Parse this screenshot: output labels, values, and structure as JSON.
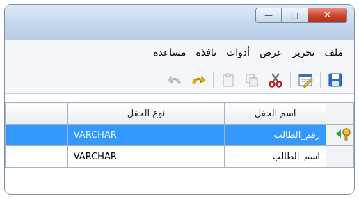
{
  "menu": {
    "items": [
      "ملف",
      "تحرير",
      "عرض",
      "أدوات",
      "نافذة",
      "مساعدة"
    ]
  },
  "window_controls": {
    "minimize_icon": "minimize-icon",
    "maximize_icon": "maximize-icon",
    "close_icon": "close-icon"
  },
  "toolbar": {
    "icons": [
      "save-icon",
      "properties-icon",
      "cut-icon",
      "copy-icon",
      "paste-icon",
      "redo-icon",
      "undo-icon"
    ]
  },
  "table": {
    "headers": {
      "field_name": "اسم الحقل",
      "field_type": "نوع الحقل"
    },
    "rows": [
      {
        "field_name": "رقم_الطالب",
        "field_type": "VARCHAR",
        "selected": true,
        "primary_key": true
      },
      {
        "field_name": "اسم_الطالب",
        "field_type": "VARCHAR",
        "selected": false,
        "primary_key": false
      }
    ]
  },
  "colors": {
    "selection": "#3399ff",
    "close_button": "#c9422c"
  }
}
